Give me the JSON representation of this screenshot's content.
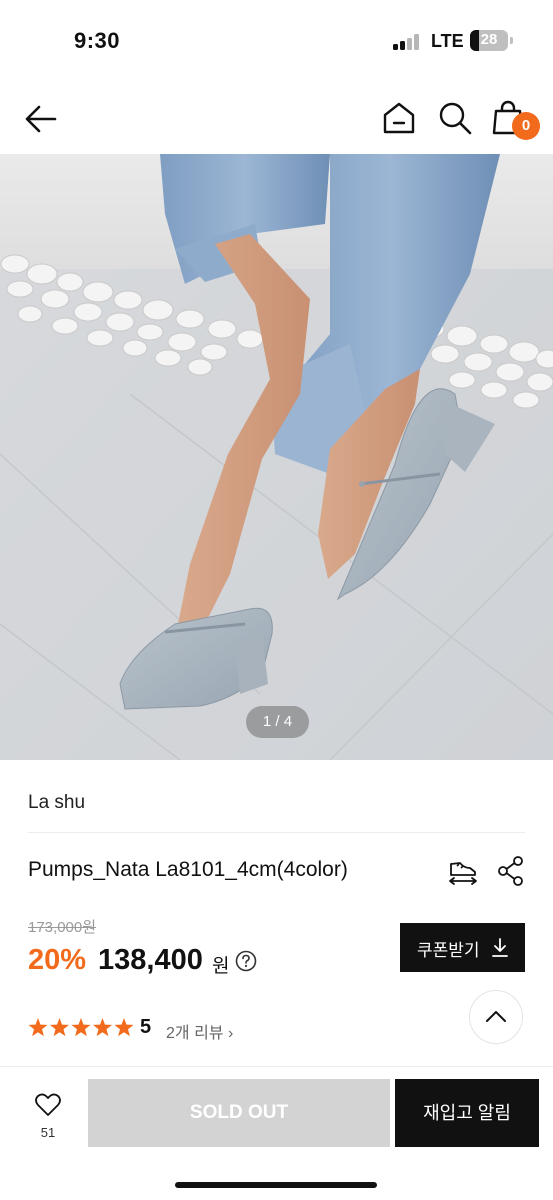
{
  "status_bar": {
    "time": "9:30",
    "network": "LTE",
    "battery": "28"
  },
  "header": {
    "back_icon": "arrow-left-icon",
    "home_icon": "home-icon",
    "search_icon": "search-icon",
    "cart_icon": "shopping-bag-icon",
    "cart_count": "0",
    "accent_color": "#f26a1b"
  },
  "gallery": {
    "counter": "1 / 4"
  },
  "product": {
    "brand": "La shu",
    "title": "Pumps_Nata La8101_4cm(4color)",
    "delivery_icon": "shoe-delivery-icon",
    "share_icon": "share-icon",
    "original_price": "173,000원",
    "discount_rate": "20%",
    "sale_price": "138,400",
    "price_unit": "원",
    "help_icon": "question-circle-icon"
  },
  "coupon": {
    "label": "쿠폰받기",
    "icon": "download-icon"
  },
  "rating": {
    "stars": 5,
    "score": "5",
    "review_link": "2개 리뷰 ›",
    "star_color": "#f26a1b"
  },
  "scroll_top": {
    "icon": "chevron-up-icon"
  },
  "bottom_bar": {
    "wish_icon": "heart-icon",
    "wish_count": "51",
    "soldout_label": "SOLD OUT",
    "restock_label": "재입고 알림"
  }
}
